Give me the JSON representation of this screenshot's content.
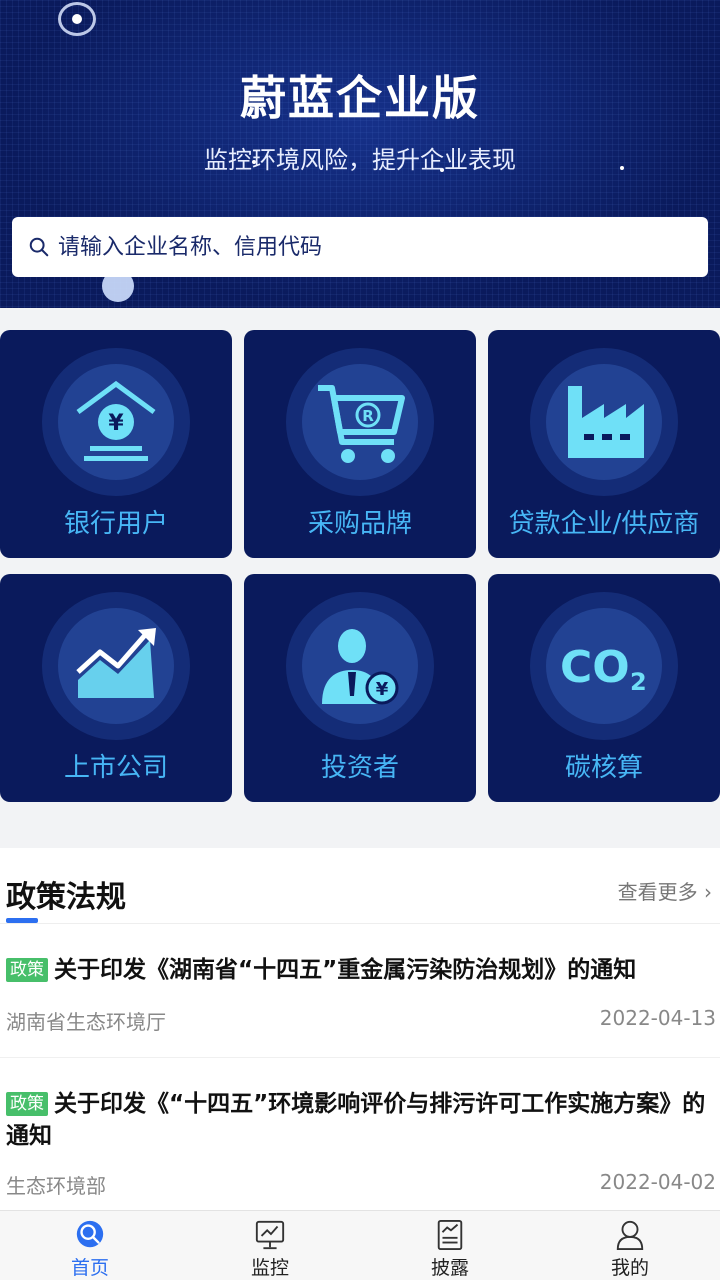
{
  "header": {
    "title": "蔚蓝企业版",
    "subtitle": "监控环境风险，提升企业表现",
    "search_placeholder": "请输入企业名称、信用代码"
  },
  "categories": [
    {
      "label": "银行用户",
      "icon": "bank-yuan-icon"
    },
    {
      "label": "采购品牌",
      "icon": "shopping-cart-icon"
    },
    {
      "label": "贷款企业/供应商",
      "icon": "factory-icon"
    },
    {
      "label": "上市公司",
      "icon": "stock-chart-icon"
    },
    {
      "label": "投资者",
      "icon": "investor-icon"
    },
    {
      "label": "碳核算",
      "icon": "co2-icon"
    }
  ],
  "policy": {
    "title": "政策法规",
    "more": "查看更多",
    "items": [
      {
        "tag": "政策",
        "title": "关于印发《湖南省“十四五”重金属污染防治规划》的通知",
        "source": "湖南省生态环境厅",
        "date": "2022-04-13"
      },
      {
        "tag": "政策",
        "title": "关于印发《“十四五”环境影响评价与排污许可工作实施方案》的通知",
        "source": "生态环境部",
        "date": "2022-04-02"
      }
    ]
  },
  "nav": [
    {
      "label": "首页",
      "icon": "home-search-icon",
      "active": true
    },
    {
      "label": "监控",
      "icon": "monitor-icon",
      "active": false
    },
    {
      "label": "披露",
      "icon": "report-icon",
      "active": false
    },
    {
      "label": "我的",
      "icon": "user-icon",
      "active": false
    }
  ],
  "colors": {
    "brand_dark": "#0a1a5c",
    "accent_cyan": "#47b6f5",
    "active_blue": "#2c6ff0",
    "tag_green": "#47bf6a"
  }
}
